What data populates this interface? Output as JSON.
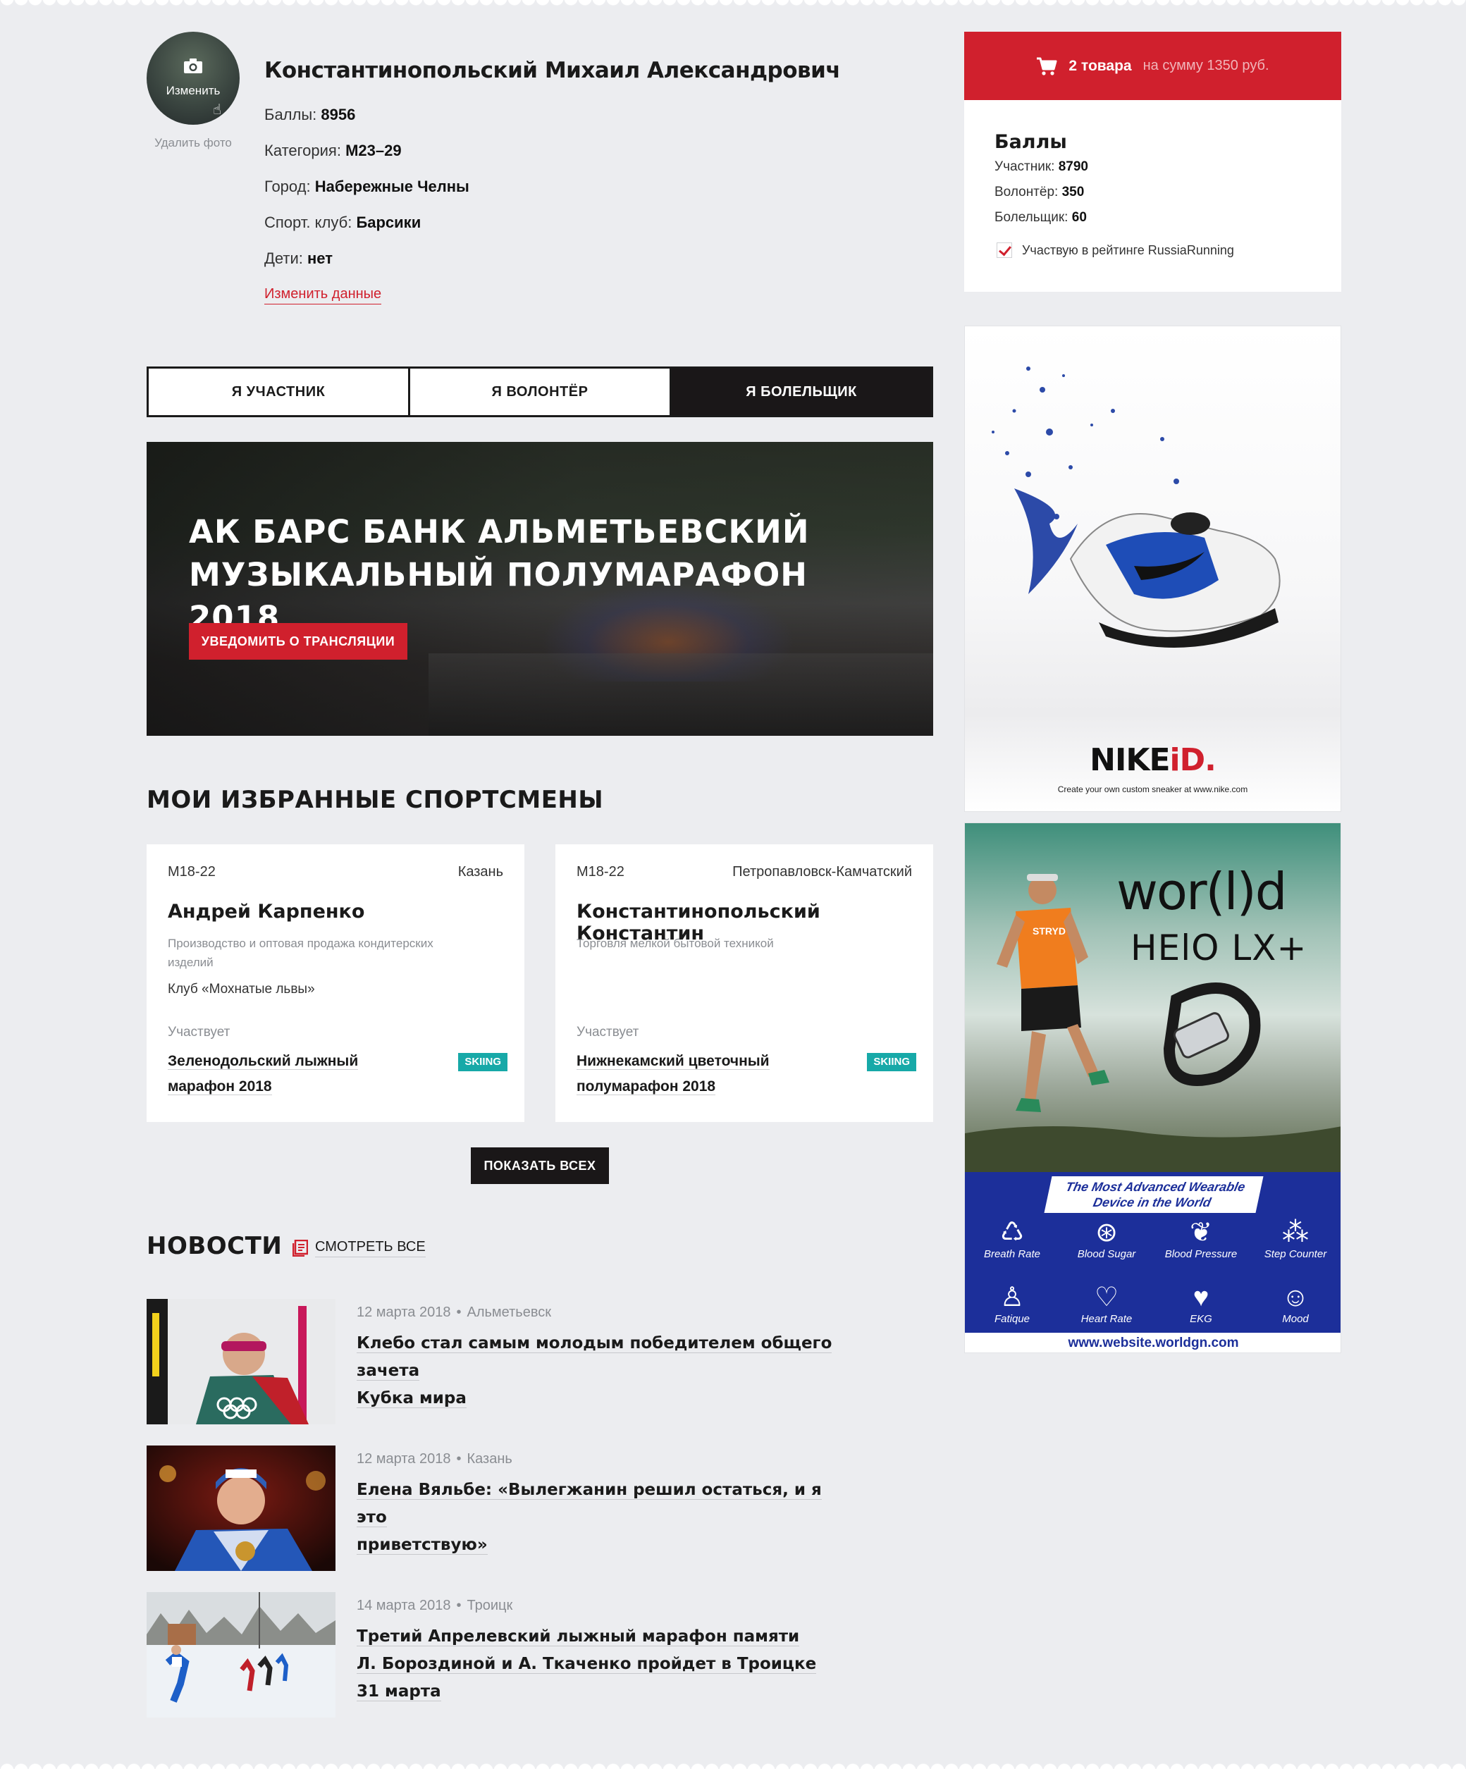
{
  "profile": {
    "avatar_label": "Изменить",
    "delete_photo": "Удалить фото",
    "name": "Константинопольский Михаил Александрович",
    "fields": [
      {
        "label": "Баллы: ",
        "value": "8956"
      },
      {
        "label": "Категория: ",
        "value": "М23–29"
      },
      {
        "label": "Город: ",
        "value": "Набережные Челны"
      },
      {
        "label": "Спорт. клуб: ",
        "value": "Барсики"
      },
      {
        "label": "Дети: ",
        "value": "нет"
      }
    ],
    "edit_link": "Изменить данные"
  },
  "tabs": [
    "Я УЧАСТНИК",
    "Я ВОЛОНТЁР",
    "Я БОЛЕЛЬЩИК"
  ],
  "active_tab": 2,
  "banner": {
    "title_line1": "АК БАРС БАНК АЛЬМЕТЬЕВСКИЙ",
    "title_line2": "МУЗЫКАЛЬНЫЙ ПОЛУМАРАФОН 2018",
    "button": "УВЕДОМИТЬ О ТРАНСЛЯЦИИ"
  },
  "favorites": {
    "title": "МОИ ИЗБРАННЫЕ СПОРТСМЕНЫ",
    "cards": [
      {
        "category": "М18-22",
        "city": "Казань",
        "name": "Андрей Карпенко",
        "description": "Производство и оптовая продажа кондитерских изделий",
        "club": "Клуб «Мохнатые львы»",
        "participates_label": "Участвует",
        "event_line1": "Зеленодольский лыжный",
        "event_line2": "марафон 2018",
        "tag": "SKIING"
      },
      {
        "category": "М18-22",
        "city": "Петропавловск-Камчатский",
        "name": "Константинопольский Константин",
        "description": "Торговля мелкой бытовой техникой",
        "club": "",
        "participates_label": "Участвует",
        "event_line1": "Нижнекамский цветочный",
        "event_line2": "полумарафон 2018",
        "tag": "SKIING"
      }
    ],
    "show_all": "ПОКАЗАТЬ ВСЕХ"
  },
  "news": {
    "title": "НОВОСТИ",
    "see_all": "СМОТРЕТЬ ВСЕ",
    "items": [
      {
        "date": "12 марта 2018",
        "city": "Альметьевск",
        "line1": "Клебо стал самым молодым победителем общего зачета",
        "line2": "Кубка мира"
      },
      {
        "date": "12 марта 2018",
        "city": "Казань",
        "line1": "Елена Вяльбе: «Вылегжанин решил остаться, и я это",
        "line2": "приветствую»"
      },
      {
        "date": "14 марта 2018",
        "city": "Троицк",
        "line1": "Третий Апрелевский лыжный марафон памяти",
        "line2": "Л. Бороздиной и А. Ткаченко пройдет в Троицке 31 марта"
      }
    ]
  },
  "cart": {
    "count": "2 товара",
    "sum": "на сумму 1350 руб."
  },
  "points": {
    "title": "Баллы",
    "rows": [
      {
        "label": "Участник: ",
        "value": "8790"
      },
      {
        "label": "Волонтёр: ",
        "value": "350"
      },
      {
        "label": "Болельщик: ",
        "value": "60"
      }
    ],
    "rating_checkbox": "Участвую в рейтинге RussiaRunning",
    "rating_checked": true
  },
  "ads": {
    "nike_brand": "NIKE",
    "nike_brand_accent": "iD.",
    "nike_tagline": "Create your own custom sneaker at www.nike.com",
    "world_logo": "wor(l)d",
    "world_model": "HElO LX+",
    "world_slogan_1": "The Most Advanced Wearable",
    "world_slogan_2": "Device in the World",
    "world_features": [
      "Breath Rate",
      "Blood Sugar",
      "Blood Pressure",
      "Step Counter",
      "Fatique",
      "Heart Rate",
      "EKG",
      "Mood"
    ],
    "world_url": "www.website.worldgn.com",
    "runner_shirt": "STRYD"
  },
  "colors": {
    "accent_red": "#d0202d",
    "dark": "#1a1718",
    "teal_tag": "#17a9a8",
    "page_bg": "#ecedf0"
  }
}
